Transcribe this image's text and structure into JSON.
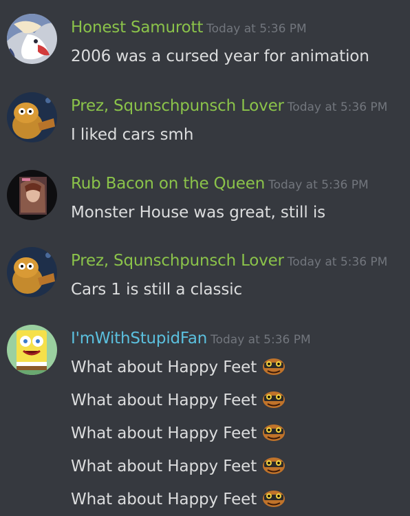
{
  "colors": {
    "background": "#36393f",
    "name_green": "#8bc34a",
    "name_cyan": "#5bc0de",
    "timestamp": "#72767d",
    "message_text": "#dcddde"
  },
  "messages": [
    {
      "username": "Honest Samurott",
      "name_color": "#8bc34a",
      "timestamp": "Today at 5:36 PM",
      "avatar_icon": "samurott-avatar",
      "lines": [
        "2006 was a cursed year for animation"
      ]
    },
    {
      "username": "Prez, Squnschpunsch Lover",
      "name_color": "#8bc34a",
      "timestamp": "Today at 5:36 PM",
      "avatar_icon": "cartoon-character-avatar",
      "lines": [
        "I liked cars smh"
      ]
    },
    {
      "username": "Rub Bacon on the Queen",
      "name_color": "#8bc34a",
      "timestamp": "Today at 5:36 PM",
      "avatar_icon": "album-cover-avatar",
      "lines": [
        "Monster House was great, still is"
      ]
    },
    {
      "username": "Prez, Squnschpunsch Lover",
      "name_color": "#8bc34a",
      "timestamp": "Today at 5:36 PM",
      "avatar_icon": "cartoon-character-avatar",
      "lines": [
        "Cars 1 is still a classic"
      ]
    },
    {
      "username": "I'mWithStupidFan",
      "name_color": "#5bc0de",
      "timestamp": "Today at 5:36 PM",
      "avatar_icon": "spongebob-avatar",
      "lines": [
        "What about Happy Feet",
        "What about Happy Feet",
        "What about Happy Feet",
        "What about Happy Feet",
        "What about Happy Feet"
      ],
      "line_emote": "frog-emote-icon"
    }
  ]
}
